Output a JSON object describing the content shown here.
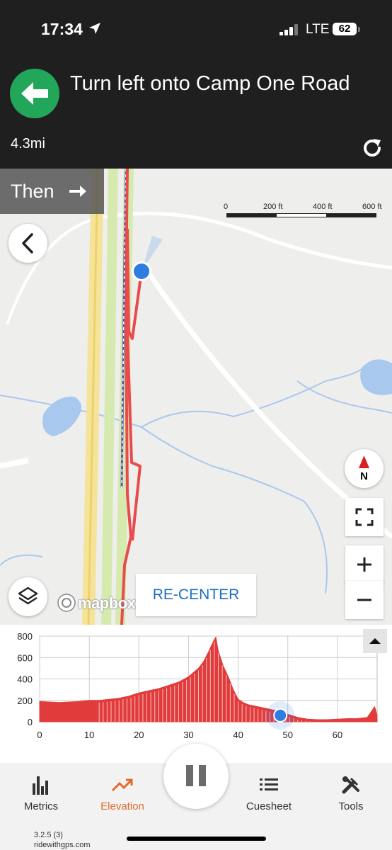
{
  "status_bar": {
    "time": "17:34",
    "carrier": "LTE",
    "battery": "62"
  },
  "navigation": {
    "instruction": "Turn left onto Camp One Road",
    "distance": "4.3mi",
    "then_label": "Then",
    "turn_icon": "arrow-left-icon",
    "next_icon": "arrow-right-icon",
    "accent_color": "#22a65a"
  },
  "map": {
    "scale_labels": [
      "0",
      "200 ft",
      "400 ft",
      "600 ft"
    ],
    "compass_label": "N",
    "recenter_label": "RE-CENTER",
    "attribution": "mapbox",
    "route_color": "#e94b4b",
    "location_color": "#2f7de1"
  },
  "chart_data": {
    "type": "area",
    "title": "",
    "xlabel": "",
    "ylabel": "",
    "xlim": [
      0,
      68
    ],
    "ylim": [
      0,
      800
    ],
    "x_ticks": [
      "0",
      "10",
      "20",
      "30",
      "40",
      "50",
      "60"
    ],
    "y_ticks": [
      "0",
      "200",
      "400",
      "600",
      "800"
    ],
    "grid": true,
    "series": [
      {
        "color": "#e23b3b",
        "x": [
          0,
          2,
          4,
          6,
          8,
          10,
          12,
          14,
          16,
          18,
          20,
          22,
          24,
          26,
          28,
          30,
          31,
          32,
          33,
          34,
          35,
          35.5,
          36,
          37,
          38,
          39,
          40,
          41,
          42,
          44,
          46,
          48,
          50,
          52,
          54,
          56,
          58,
          60,
          62,
          64,
          66,
          67.5,
          68
        ],
        "y": [
          190,
          185,
          180,
          185,
          190,
          200,
          200,
          210,
          220,
          240,
          270,
          290,
          310,
          340,
          370,
          420,
          460,
          500,
          560,
          650,
          750,
          790,
          660,
          520,
          420,
          300,
          210,
          180,
          160,
          140,
          120,
          100,
          70,
          40,
          25,
          20,
          20,
          25,
          30,
          30,
          40,
          140,
          60
        ]
      }
    ],
    "current_position": {
      "x": 48.5,
      "y": 60
    }
  },
  "tabs": [
    {
      "label": "Metrics",
      "icon": "bar-chart-icon",
      "active": false
    },
    {
      "label": "Elevation",
      "icon": "trend-line-icon",
      "active": true
    },
    {
      "label": "Cuesheet",
      "icon": "list-icon",
      "active": false
    },
    {
      "label": "Tools",
      "icon": "tools-icon",
      "active": false
    }
  ],
  "pause_icon": "pause-icon",
  "active_tab_color": "#e06c2c",
  "footer": {
    "version": "3.2.5 (3)",
    "site": "ridewithgps.com"
  }
}
